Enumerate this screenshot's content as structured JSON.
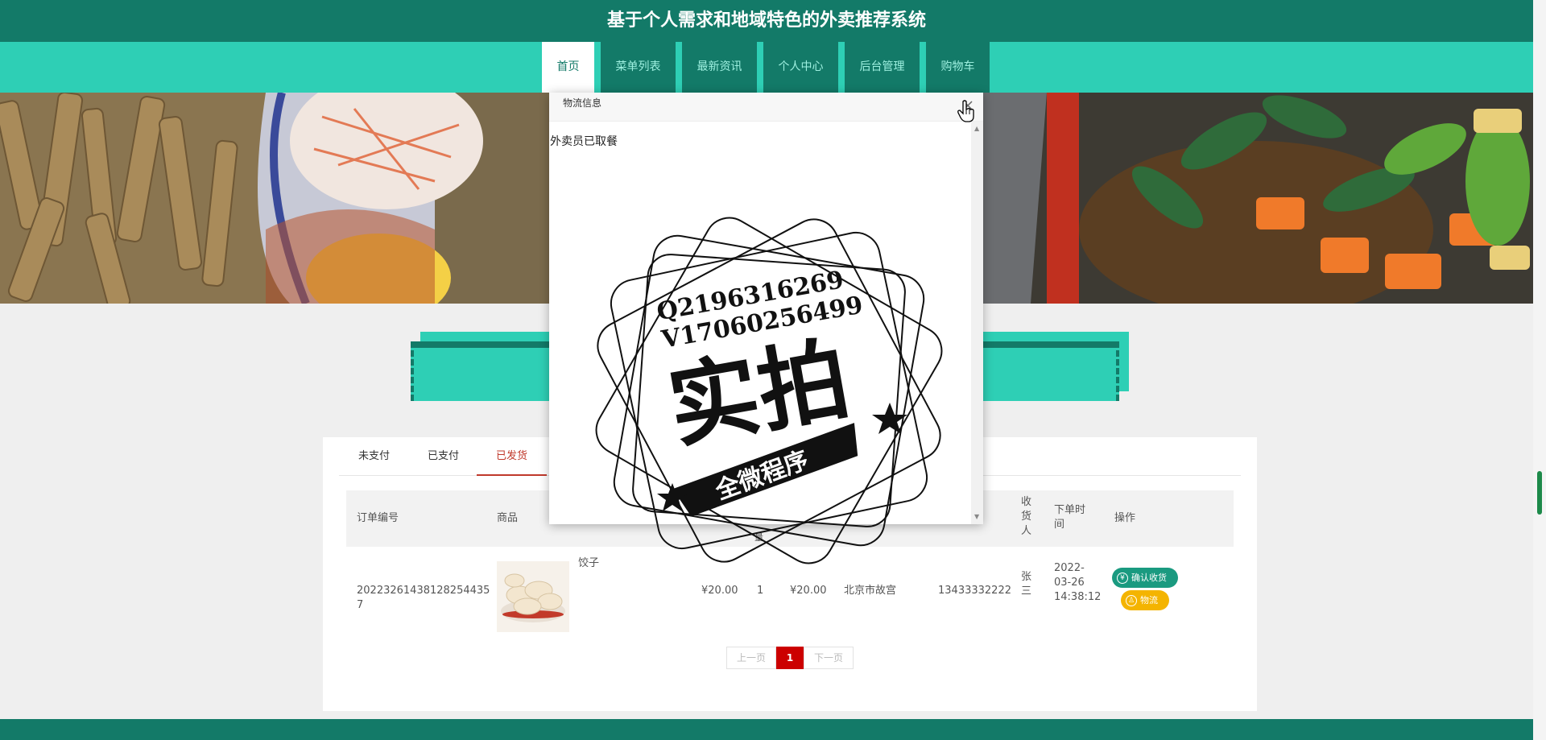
{
  "header": {
    "site_title": "基于个人需求和地域特色的外卖推荐系统"
  },
  "nav": {
    "items": [
      {
        "label": "首页",
        "active": true
      },
      {
        "label": "菜单列表",
        "active": false
      },
      {
        "label": "最新资讯",
        "active": false
      },
      {
        "label": "个人中心",
        "active": false
      },
      {
        "label": "后台管理",
        "active": false
      },
      {
        "label": "购物车",
        "active": false
      }
    ]
  },
  "orders": {
    "tabs": [
      {
        "label": "未支付",
        "active": false
      },
      {
        "label": "已支付",
        "active": false
      },
      {
        "label": "已发货",
        "active": true
      }
    ],
    "columns": {
      "order_no": "订单编号",
      "product": "商品",
      "quantity_partial": "量",
      "receiver": "收货人",
      "order_time": "下单时间",
      "actions": "操作"
    },
    "rows": [
      {
        "order_no": "20223261438128254435 7",
        "product_name": "饺子",
        "price": "¥20.00",
        "quantity": "1",
        "total": "¥20.00",
        "address": "北京市故宫",
        "phone": "13433332222",
        "receiver": "张三",
        "order_time": "2022-03-26 14:38:12",
        "confirm_label": "确认收货",
        "logistics_label": "物流"
      }
    ],
    "pager": {
      "prev": "上一页",
      "current": "1",
      "next": "下一页"
    }
  },
  "modal": {
    "title": "物流信息",
    "message": "外卖员已取餐"
  },
  "watermark": {
    "line1": "Q2196316269",
    "line2": "V17060256499",
    "main": "实拍",
    "ribbon": "全微程序"
  },
  "colors": {
    "primary_dark": "#137a68",
    "primary_light": "#2ecfb5",
    "active_tab": "#c0392b",
    "confirm_button": "#1a9a80",
    "logistics_button": "#f4b400",
    "pager_current": "#cc0000"
  }
}
